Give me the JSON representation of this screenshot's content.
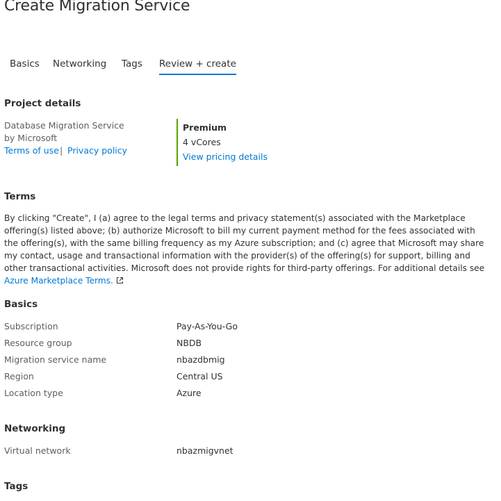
{
  "title": "Create Migration Service",
  "tabs": [
    {
      "label": "Basics"
    },
    {
      "label": "Networking"
    },
    {
      "label": "Tags"
    },
    {
      "label": "Review + create",
      "active": true
    }
  ],
  "project_details": {
    "heading": "Project details",
    "product_name": "Database Migration Service",
    "publisher": "by Microsoft",
    "terms_of_use": "Terms of use",
    "separator": "|",
    "privacy_policy": "Privacy policy",
    "plan": {
      "name": "Premium",
      "cores": "4 vCores",
      "pricing_link": "View pricing details"
    }
  },
  "terms": {
    "heading": "Terms",
    "body": "By clicking \"Create\", I (a) agree to the legal terms and privacy statement(s) associated with the Marketplace offering(s) listed above; (b) authorize Microsoft to bill my current payment method for the fees associated with the offering(s), with the same billing frequency as my Azure subscription; and (c) agree that Microsoft may share my contact, usage and transactional information with the provider(s) of the offering(s) for support, billing and other transactional activities. Microsoft does not provide rights for third-party offerings. For additional details see ",
    "link": "Azure Marketplace Terms.",
    "link_icon": "external-link-icon"
  },
  "basics": {
    "heading": "Basics",
    "rows": [
      {
        "label": "Subscription",
        "value": "Pay-As-You-Go"
      },
      {
        "label": "Resource group",
        "value": "NBDB"
      },
      {
        "label": "Migration service name",
        "value": "nbazdbmig"
      },
      {
        "label": "Region",
        "value": "Central US"
      },
      {
        "label": "Location type",
        "value": "Azure"
      }
    ]
  },
  "networking": {
    "heading": "Networking",
    "rows": [
      {
        "label": "Virtual network",
        "value": "nbazmigvnet"
      }
    ]
  },
  "tags": {
    "heading": "Tags"
  },
  "colors": {
    "accent": "#0078d4",
    "plan_bar": "#57a300",
    "text": "#323130",
    "muted": "#605e5c"
  }
}
